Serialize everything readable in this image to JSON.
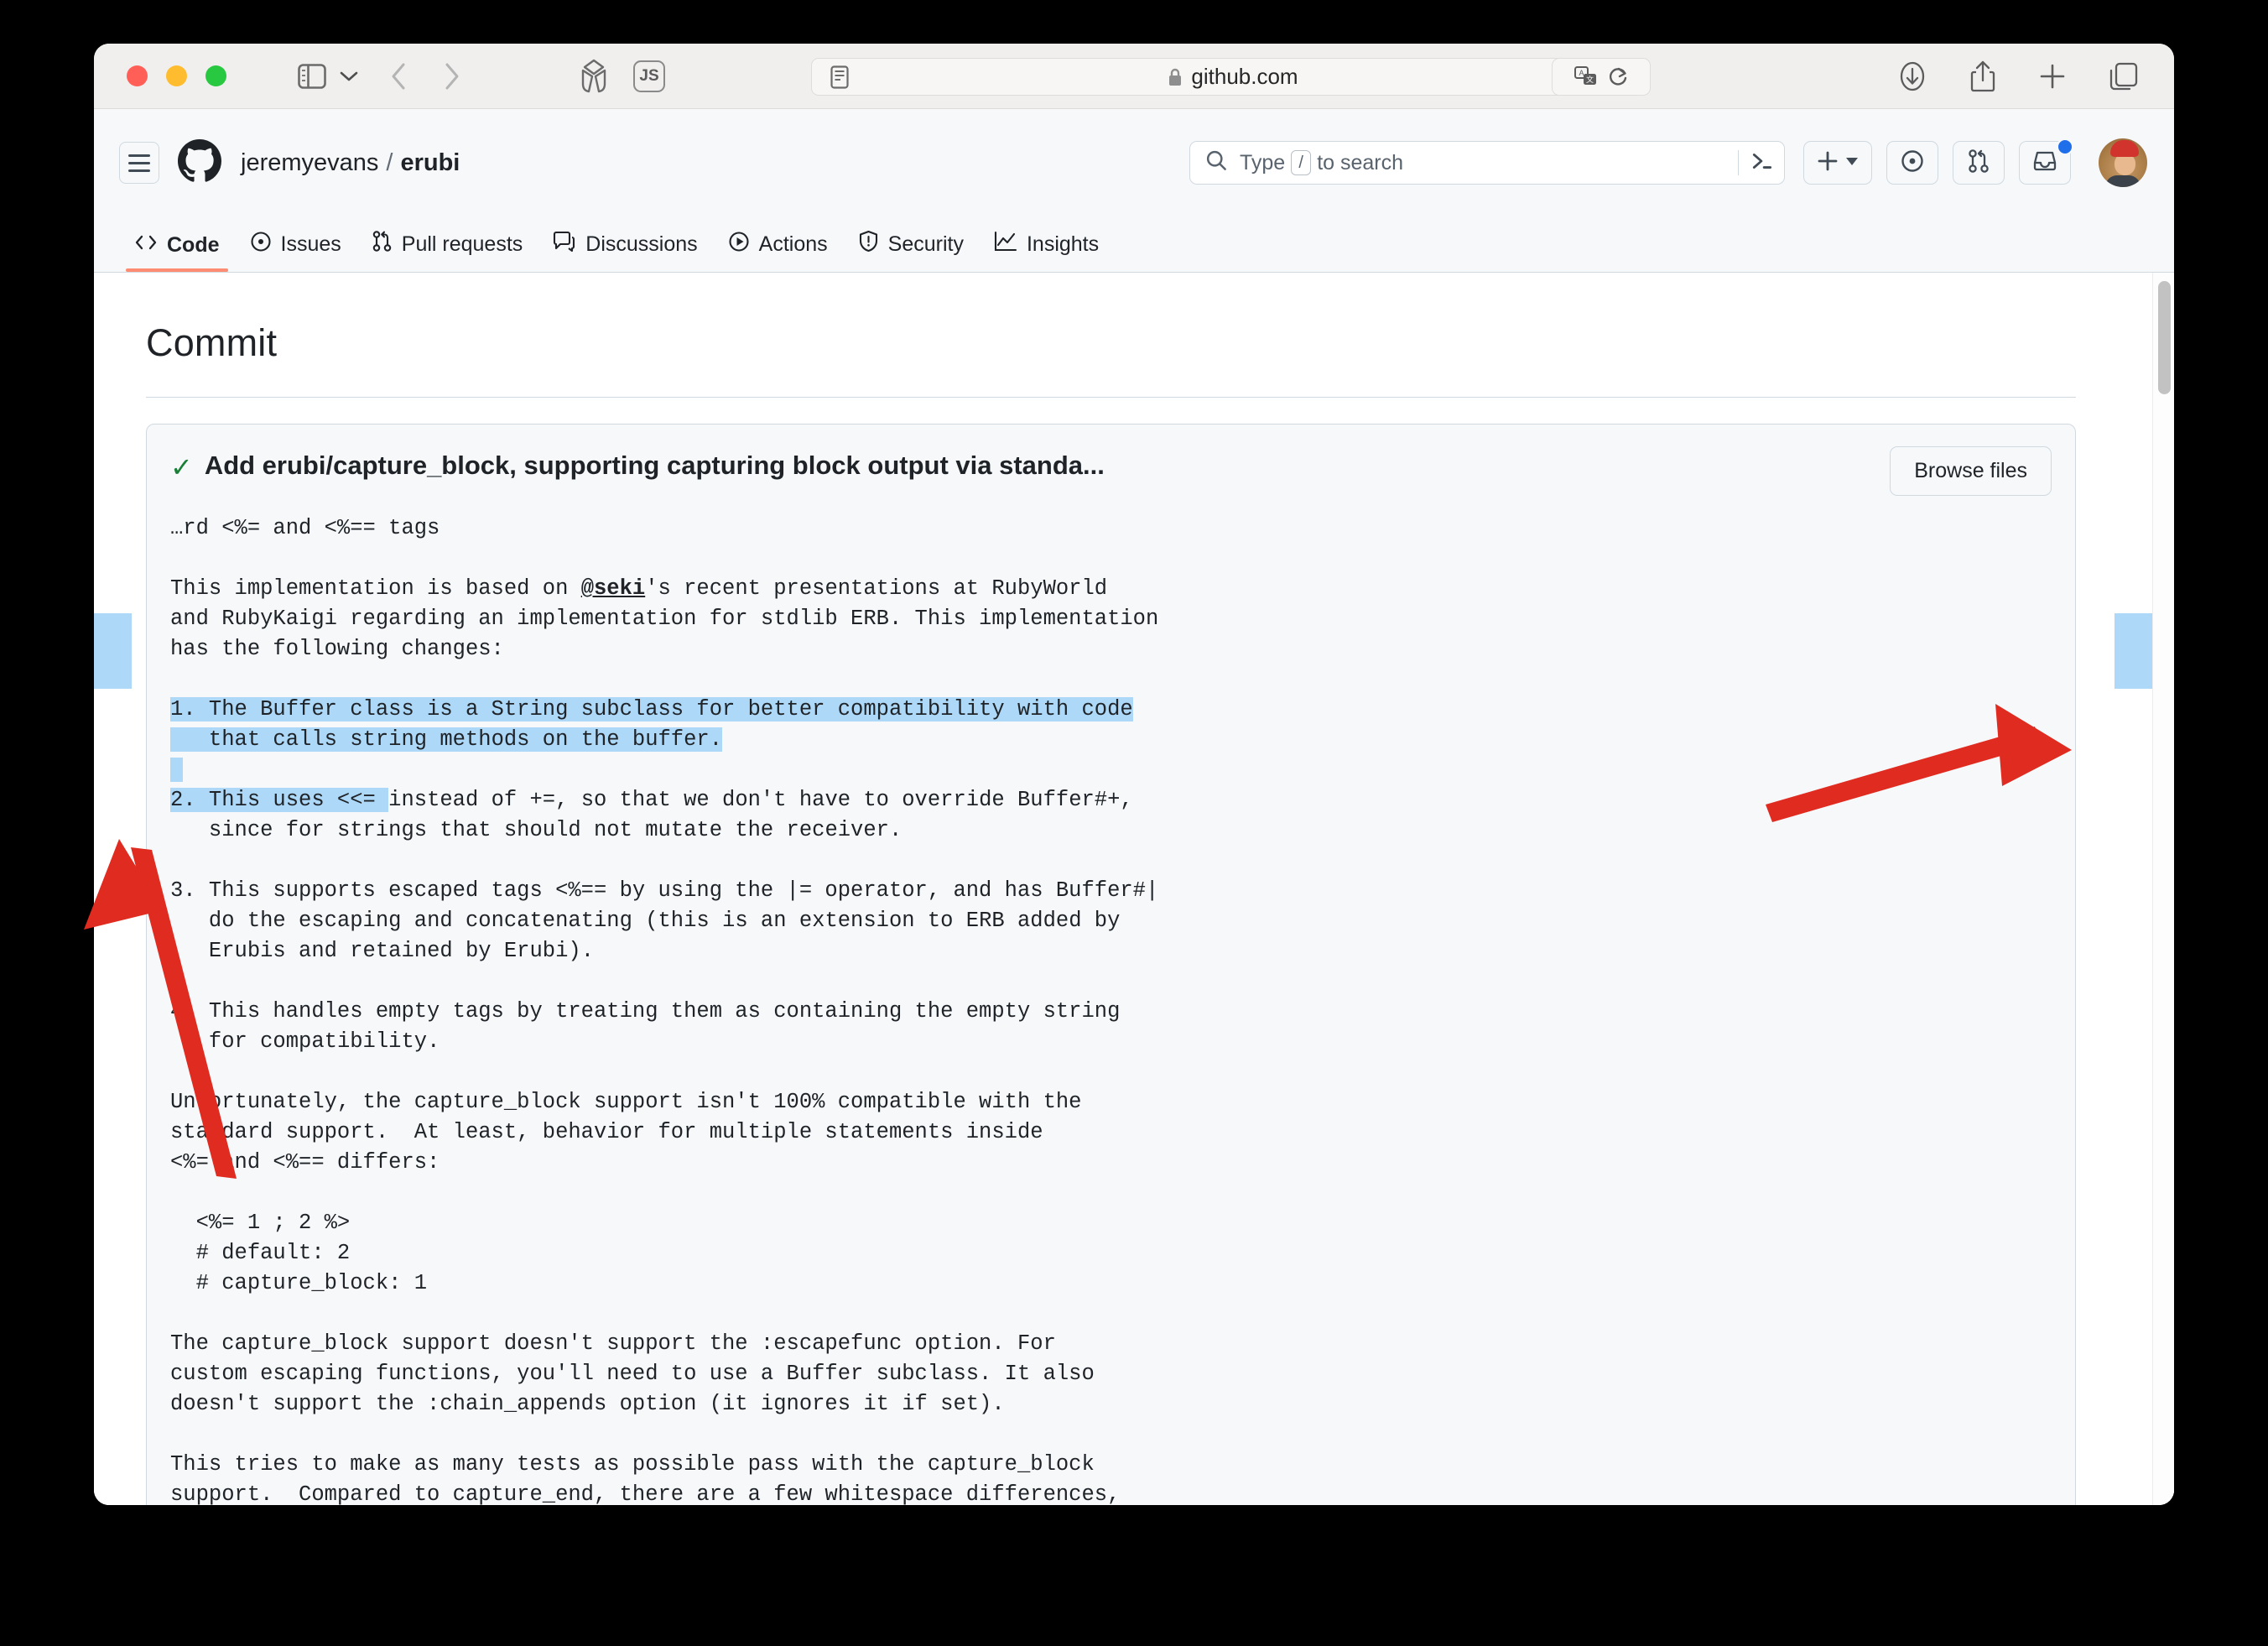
{
  "browser": {
    "traffic_lights": [
      "close",
      "minimize",
      "zoom"
    ],
    "url": "github.com",
    "secure": true,
    "toolbar_icons": {
      "sidebar": "sidebar-icon",
      "sidebar_chevron": "chevron-down-icon",
      "back": "chevron-left-icon",
      "forward": "chevron-right-icon",
      "extension": "cube-icon",
      "js_badge": "JS",
      "reader": "reader-icon",
      "lock": "lock-icon",
      "translate": "translate-icon",
      "reload": "reload-icon",
      "downloads": "download-icon",
      "share": "share-icon",
      "new_tab": "plus-icon",
      "tab_overview": "tabs-icon"
    }
  },
  "github": {
    "hamburger_label": "hamburger-menu",
    "owner": "jeremyevans",
    "separator": "/",
    "repo": "erubi",
    "search": {
      "placeholder_prefix": "Type",
      "key_hint": "/",
      "placeholder_suffix": "to search",
      "command_palette_icon": "terminal-icon"
    },
    "actions": {
      "create_new": "plus-icon",
      "create_new_caret": "caret-down-icon",
      "issues": "issue-opened-icon",
      "pull_requests": "git-pull-request-icon",
      "inbox": "inbox-icon",
      "inbox_has_notification": true,
      "avatar": "user-avatar"
    },
    "nav_tabs": [
      {
        "label": "Code",
        "icon": "code-icon",
        "active": true
      },
      {
        "label": "Issues",
        "icon": "issue-opened-icon",
        "active": false
      },
      {
        "label": "Pull requests",
        "icon": "git-pull-request-icon",
        "active": false
      },
      {
        "label": "Discussions",
        "icon": "comment-discussion-icon",
        "active": false
      },
      {
        "label": "Actions",
        "icon": "play-icon",
        "active": false
      },
      {
        "label": "Security",
        "icon": "shield-icon",
        "active": false
      },
      {
        "label": "Insights",
        "icon": "graph-icon",
        "active": false
      }
    ]
  },
  "page": {
    "title": "Commit",
    "commit": {
      "verified_icon": "check-icon",
      "title": "Add erubi/capture_block, supporting capturing block output via standa...",
      "browse_files_label": "Browse files",
      "body_lines": [
        "…rd <%= and <%== tags",
        "",
        "This implementation is based on @seki's recent presentations at RubyWorld",
        "and RubyKaigi regarding an implementation for stdlib ERB. This implementation",
        "has the following changes:",
        "",
        "1. The Buffer class is a String subclass for better compatibility with code",
        "   that calls string methods on the buffer.",
        "",
        "2. This uses <<= instead of +=, so that we don't have to override Buffer#+,",
        "   since for strings that should not mutate the receiver.",
        "",
        "3. This supports escaped tags <%== by using the |= operator, and has Buffer#|",
        "   do the escaping and concatenating (this is an extension to ERB added by",
        "   Erubis and retained by Erubi).",
        "",
        "4. This handles empty tags by treating them as containing the empty string",
        "   for compatibility.",
        "",
        "Unfortunately, the capture_block support isn't 100% compatible with the",
        "standard support.  At least, behavior for multiple statements inside",
        "<%= and <%== differs:",
        "",
        "  <%= 1 ; 2 %>",
        "  # default: 2",
        "  # capture_block: 1",
        "",
        "The capture_block support doesn't support the :escapefunc option. For",
        "custom escaping functions, you'll need to use a Buffer subclass. It also",
        "doesn't support the :chain_appends option (it ignores it if set).",
        "",
        "This tries to make as many tests as possible pass with the capture_block",
        "support.  Compared to capture_end, there are a few whitespace differences,"
      ],
      "mention": "@seki",
      "selection": {
        "highlight_color": "#add8f7",
        "selected_text": "The Buffer class is a String subclass for better compatibility with code that calls string methods on the buffer.\n\n2. This uses <<= ins"
      }
    }
  },
  "annotations": {
    "arrow_color": "#e02b20",
    "arrows": [
      {
        "name": "left-selection-arrow",
        "points_to": "left-edge-selection-block"
      },
      {
        "name": "right-selection-arrow",
        "points_to": "right-edge-selection-block"
      }
    ]
  },
  "scrollbar": {
    "name": "page-scrollbar",
    "position": "top"
  }
}
